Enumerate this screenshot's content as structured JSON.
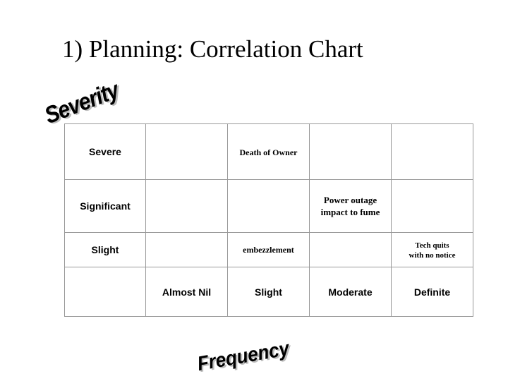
{
  "slide": {
    "title": "1) Planning: Correlation Chart",
    "background_color": "#ffffff",
    "grid_color": "#999999",
    "text_color": "#000000"
  },
  "axes": {
    "y_label": "Severity",
    "x_label": "Frequency"
  },
  "chart_data": {
    "type": "table",
    "title": "1) Planning: Correlation Chart",
    "xlabel": "Frequency",
    "ylabel": "Severity",
    "columns": [
      "",
      "Almost Nil",
      "Slight",
      "Moderate",
      "Definite"
    ],
    "rows": [
      {
        "label": "Severe",
        "cells": [
          "",
          "Death of Owner",
          "",
          ""
        ]
      },
      {
        "label": "Significant",
        "cells": [
          "",
          "",
          "Power outage impact to fume",
          ""
        ]
      },
      {
        "label": "Slight",
        "cells": [
          "",
          "embezzlement",
          "",
          "Tech quits with no notice"
        ]
      }
    ],
    "entries": [
      {
        "severity": "Severe",
        "frequency": "Slight",
        "text": "Death of Owner"
      },
      {
        "severity": "Significant",
        "frequency": "Moderate",
        "text": "Power outage impact to fume"
      },
      {
        "severity": "Slight",
        "frequency": "Slight",
        "text": "embezzlement"
      },
      {
        "severity": "Slight",
        "frequency": "Definite",
        "text": "Tech quits with no notice"
      }
    ]
  },
  "matrix": {
    "severity_levels": [
      "Severe",
      "Significant",
      "Slight"
    ],
    "frequency_levels": [
      "Almost Nil",
      "Slight",
      "Moderate",
      "Definite"
    ],
    "entry_death_of_owner": "Death of Owner",
    "entry_power_outage_line1": "Power outage",
    "entry_power_outage_line2": "impact to fume",
    "entry_embezzlement": "embezzlement",
    "entry_tech_quits_line1": "Tech quits",
    "entry_tech_quits_line2": "with no notice"
  }
}
